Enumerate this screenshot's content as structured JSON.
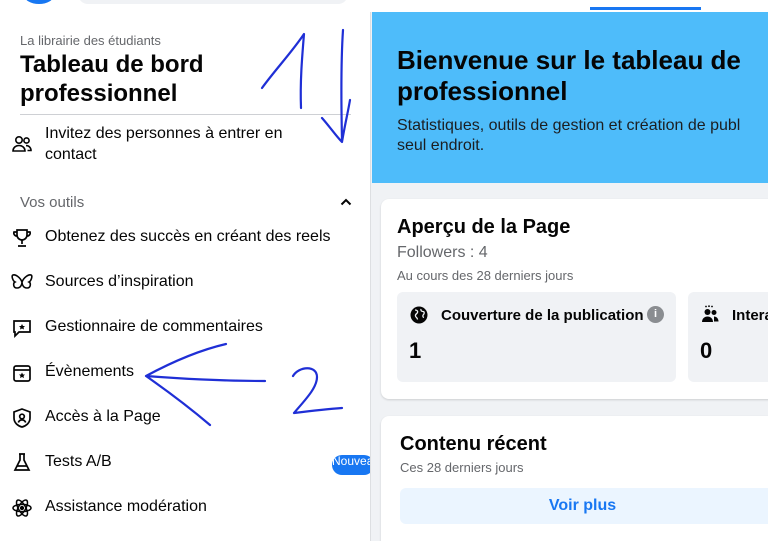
{
  "sidebar": {
    "subtitle": "La librairie des étudiants",
    "title_line1": "Tableau de bord",
    "title_line2": "professionnel",
    "invite_label": "Invitez des personnes à entrer en contact",
    "tools_header": "Vos outils",
    "items": [
      {
        "label": "Obtenez des succès en créant des reels",
        "icon": "trophy-icon"
      },
      {
        "label": "Sources d’inspiration",
        "icon": "butterfly-icon"
      },
      {
        "label": "Gestionnaire de commentaires",
        "icon": "comment-icon"
      },
      {
        "label": "Évènements",
        "icon": "calendar-star-icon"
      },
      {
        "label": "Accès à la Page",
        "icon": "shield-user-icon"
      },
      {
        "label": "Tests A/B",
        "icon": "flask-icon"
      },
      {
        "label": "Assistance modération",
        "icon": "atom-icon"
      }
    ],
    "ab_badge": "Nouveau"
  },
  "banner": {
    "title_line1": "Bienvenue sur le tableau de",
    "title_line2": "professionnel",
    "desc_line1": "Statistiques, outils de gestion et création de publ",
    "desc_line2": "seul endroit."
  },
  "overview": {
    "title": "Aperçu de la Page",
    "followers": "Followers : 4",
    "period": "Au cours des 28 derniers jours",
    "stats": [
      {
        "label": "Couverture de la publication",
        "value": "1",
        "icon": "globe-icon"
      },
      {
        "label": "Interac",
        "value": "0",
        "icon": "people-icon"
      }
    ],
    "info_glyph": "i"
  },
  "recent": {
    "title": "Contenu récent",
    "period": "Ces 28 derniers jours",
    "button": "Voir plus"
  },
  "annotations": {
    "label1": "1",
    "label2": "2"
  },
  "colors": {
    "brand": "#1877f2",
    "banner": "#4ebcfa",
    "annotation_ink": "#1f2fd6"
  }
}
